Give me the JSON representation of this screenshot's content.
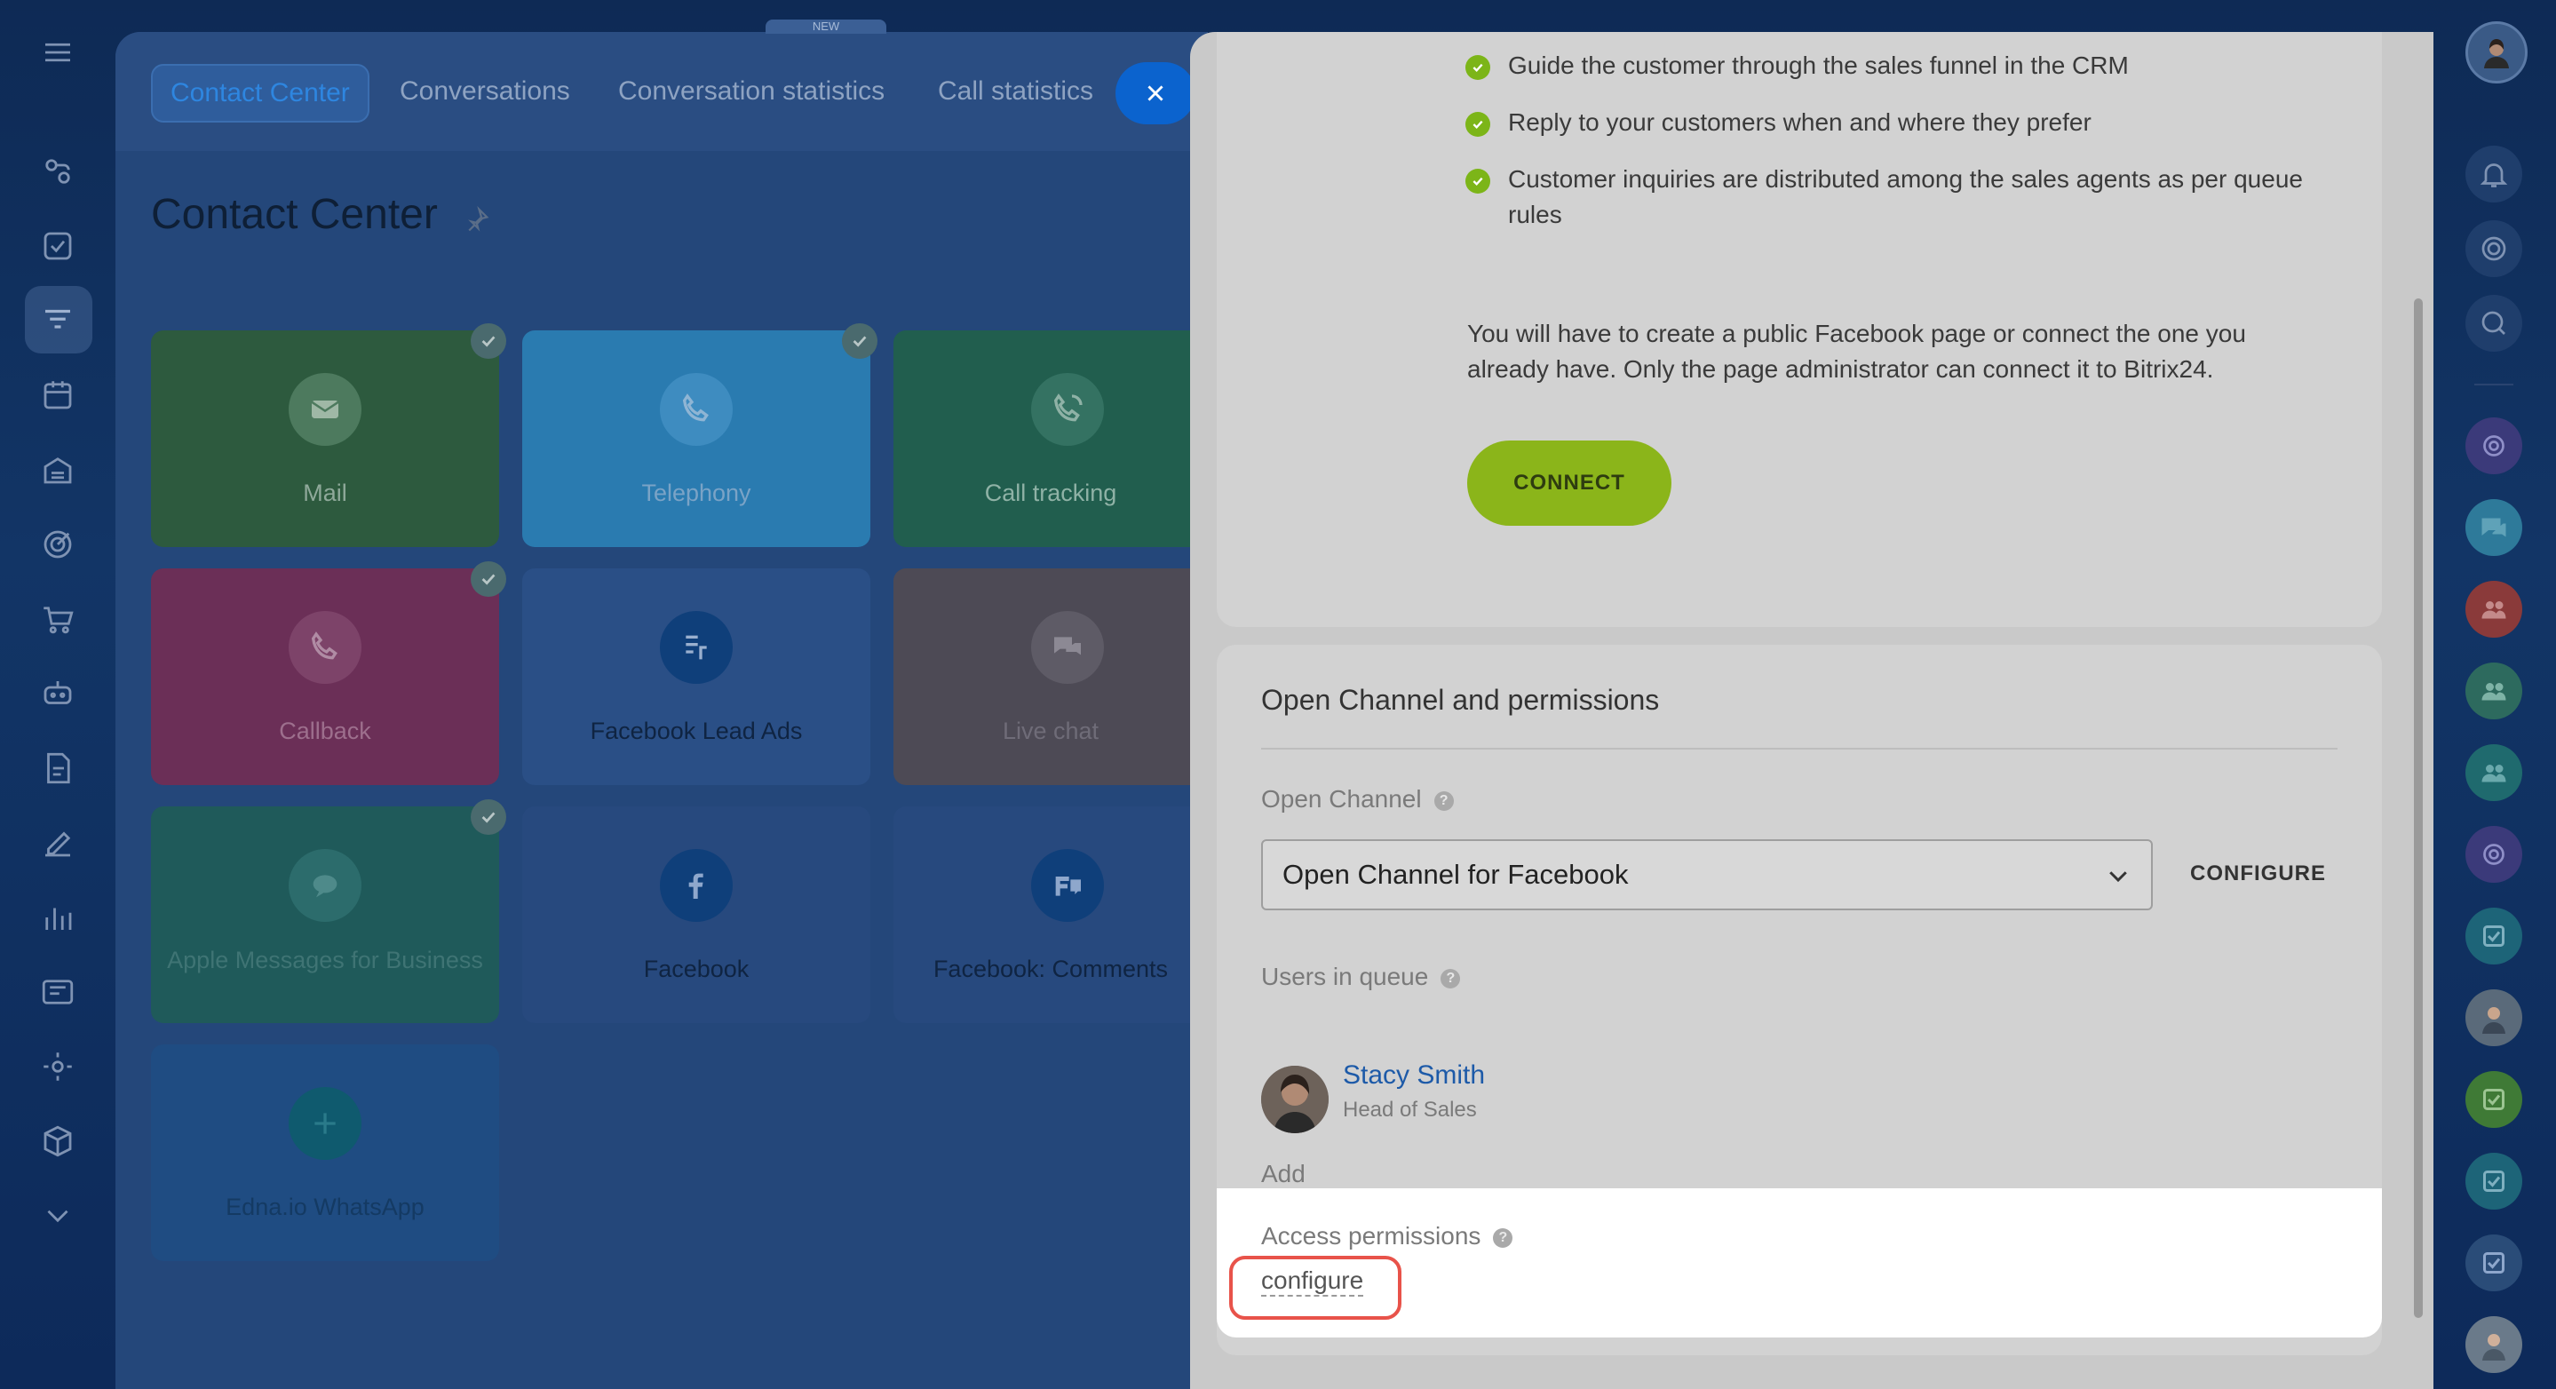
{
  "main": {
    "tabs": [
      {
        "label": "Contact Center",
        "active": true
      },
      {
        "label": "Conversations"
      },
      {
        "label": "Conversation statistics"
      },
      {
        "label": "Call statistics"
      }
    ],
    "new_badge": "NEW",
    "page_title": "Contact Center",
    "tiles": [
      {
        "label": "Mail",
        "icon": "mail-icon",
        "color": "#2d5a3e",
        "checked": true
      },
      {
        "label": "Telephony",
        "icon": "phone-icon",
        "color": "#2a7bb0",
        "checked": true
      },
      {
        "label": "Call tracking",
        "icon": "call-tracking-icon",
        "color": "#215e4e",
        "checked": false
      },
      {
        "label": "Callback",
        "icon": "callback-icon",
        "color": "#6b2f57",
        "checked": true
      },
      {
        "label": "Facebook Lead Ads",
        "icon": "facebook-lead-ads-icon",
        "color": "#2a4f86",
        "checked": false
      },
      {
        "label": "Live chat",
        "icon": "chat-icon",
        "color": "#4d4a55",
        "checked": false
      },
      {
        "label": "Apple Messages for Business",
        "icon": "apple-messages-icon",
        "color": "#1f5a5a",
        "checked": true
      },
      {
        "label": "Facebook",
        "icon": "facebook-icon",
        "color": "#27497e",
        "checked": false
      },
      {
        "label": "Facebook: Comments",
        "icon": "facebook-comments-icon",
        "color": "#27497e",
        "checked": false
      },
      {
        "label": "Edna.io WhatsApp",
        "icon": "edna-icon",
        "color": "#1f4c82",
        "checked": false
      }
    ]
  },
  "slider": {
    "features": [
      "Guide the customer through the sales funnel in the CRM",
      "Reply to your customers when and where they prefer",
      "Customer inquiries are distributed among the sales agents as per queue rules"
    ],
    "info_text": "You will have to create a public Facebook page or connect the one you already have. Only the page administrator can connect it to Bitrix24.",
    "connect_label": "CONNECT",
    "section_title": "Open Channel and permissions",
    "open_channel_label": "Open Channel",
    "open_channel_value": "Open Channel for Facebook",
    "configure_label": "CONFIGURE",
    "users_label": "Users in queue",
    "user": {
      "name": "Stacy Smith",
      "role": "Head of Sales"
    },
    "add_label": "Add",
    "access_label": "Access permissions",
    "access_link": "configure",
    "help_mark": "?"
  },
  "colors": {
    "accent": "#8bb51a",
    "link": "#1d5aa8",
    "highlight": "#e8534a",
    "check": "#7cb518"
  }
}
